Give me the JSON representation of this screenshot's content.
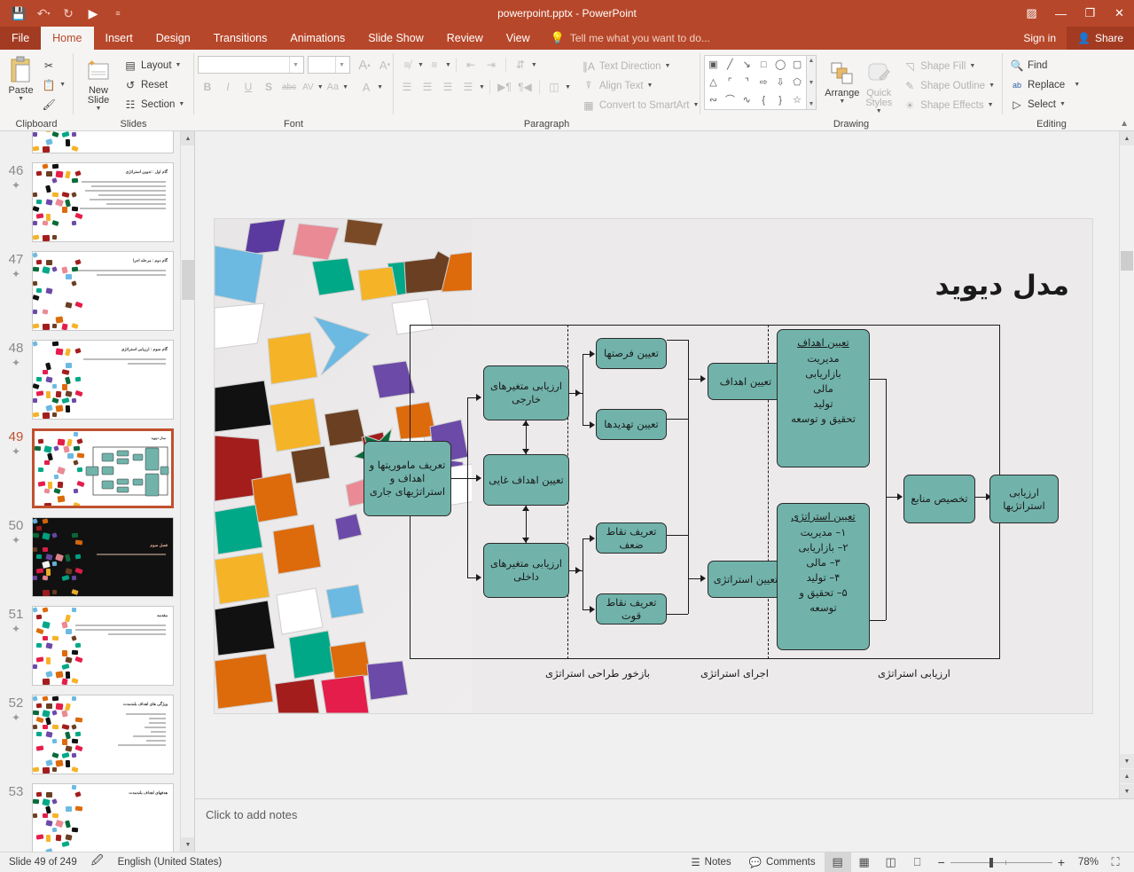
{
  "window": {
    "title": "powerpoint.pptx - PowerPoint",
    "quick_access": [
      {
        "name": "save-icon",
        "glyph": "💾"
      },
      {
        "name": "undo-icon",
        "glyph": "↶"
      },
      {
        "name": "redo-icon",
        "glyph": "↻"
      },
      {
        "name": "start-slideshow-icon",
        "glyph": "▶"
      },
      {
        "name": "customize-qat-icon",
        "glyph": "≡"
      }
    ],
    "controls": [
      {
        "name": "ribbon-display-options",
        "glyph": "▣"
      },
      {
        "name": "minimize",
        "glyph": "—"
      },
      {
        "name": "restore",
        "glyph": "❐"
      },
      {
        "name": "close",
        "glyph": "✕"
      }
    ]
  },
  "tabs": [
    {
      "label": "File",
      "active": false
    },
    {
      "label": "Home",
      "active": true
    },
    {
      "label": "Insert",
      "active": false
    },
    {
      "label": "Design",
      "active": false
    },
    {
      "label": "Transitions",
      "active": false
    },
    {
      "label": "Animations",
      "active": false
    },
    {
      "label": "Slide Show",
      "active": false
    },
    {
      "label": "Review",
      "active": false
    },
    {
      "label": "View",
      "active": false
    }
  ],
  "tell_me": "Tell me what you want to do...",
  "sign_in": "Sign in",
  "share": "Share",
  "ribbon": {
    "clipboard": {
      "label": "Clipboard",
      "paste": "Paste",
      "cut_icon": "scissors-icon",
      "copy_icon": "copy-icon",
      "format_painter_icon": "format-painter-icon"
    },
    "slides": {
      "label": "Slides",
      "new_slide": "New Slide",
      "layout": "Layout",
      "reset": "Reset",
      "section": "Section"
    },
    "font": {
      "label": "Font",
      "font_name": "",
      "font_size": "",
      "grow_font": "A",
      "shrink_font": "A",
      "clear_formatting": "clear-formatting-icon",
      "bold": "B",
      "italic": "I",
      "underline": "U",
      "shadow": "S",
      "strikethrough": "abc",
      "character_spacing": "AV",
      "change_case": "Aa",
      "font_color": "A"
    },
    "paragraph": {
      "label": "Paragraph",
      "text_direction": "Text Direction",
      "align_text": "Align Text",
      "convert_to_smartart": "Convert to SmartArt"
    },
    "drawing": {
      "label": "Drawing",
      "arrange": "Arrange",
      "quick_styles": "Quick Styles",
      "shape_fill": "Shape Fill",
      "shape_outline": "Shape Outline",
      "shape_effects": "Shape Effects",
      "shapes": [
        "A≡",
        "╲",
        "↘",
        "□",
        "◯",
        "▢",
        "△",
        "┐",
        "┗",
        "⇨",
        "⇩",
        "⌐",
        "ʃ",
        "⌒",
        "∿",
        "{",
        "}",
        "☆"
      ]
    },
    "editing": {
      "label": "Editing",
      "find": "Find",
      "replace": "Replace",
      "select": "Select"
    }
  },
  "thumbnails": [
    {
      "number": "",
      "title": "",
      "lines": 0,
      "selected": false,
      "dark": false,
      "partial": true
    },
    {
      "number": "46",
      "title": "گام اول : تدوین استراتژی",
      "lines": 7,
      "selected": false,
      "dark": false
    },
    {
      "number": "47",
      "title": "گام دوم : مرحله اجرا",
      "lines": 2,
      "selected": false,
      "dark": false
    },
    {
      "number": "48",
      "title": "گام سوم : ارزیابی استراتژی",
      "lines": 2,
      "selected": false,
      "dark": false
    },
    {
      "number": "49",
      "title": "مدل دیوید",
      "lines": 0,
      "selected": true,
      "dark": false,
      "diagram": true
    },
    {
      "number": "50",
      "title": "فصل سوم",
      "lines": 1,
      "selected": false,
      "dark": true
    },
    {
      "number": "51",
      "title": "مقدمه",
      "lines": 3,
      "selected": false,
      "dark": false
    },
    {
      "number": "52",
      "title": "ویژگی های اهداف بلندمدت",
      "lines": 7,
      "selected": false,
      "dark": false
    },
    {
      "number": "53",
      "title": "هدفهای اهداف بلندمدت",
      "lines": 0,
      "selected": false,
      "dark": false,
      "partial": true
    }
  ],
  "slide": {
    "title": "مدل دیوید",
    "nodes": {
      "mission": "تعریف ماموریتها و اهداف و استراتژیهای جاری",
      "external": "ارزیابی متغیرهای خارجی",
      "ultimate_goals": "تعیین اهداف غایی",
      "internal": "ارزیابی متغیرهای داخلی",
      "opportunities": "تعیین فرصتها",
      "threats": "تعیین تهدیدها",
      "weaknesses": "تعریف نقاط ضعف",
      "strengths": "تعریف نقاط قوت",
      "set_goals": "تعیین اهداف",
      "set_strategy": "تعیین استراتژی",
      "allocate": "تخصیص منابع",
      "evaluate": "ارزیابی استراتژیها"
    },
    "goals_panel": {
      "header": "تعیین اهداف",
      "items": [
        "مدیریت",
        "بازاریابی",
        "مالی",
        "تولید",
        "تحقیق و توسعه"
      ]
    },
    "strategy_panel": {
      "header": "تعیین استراتژی",
      "items": [
        "۱– مدیریت",
        "۲– بازاریابی",
        "۳– مالی",
        "۴– تولید",
        "۵– تحقیق و توسعه"
      ]
    },
    "phase_labels": [
      "بازخور طراحی استراتژی",
      "اجرای استراتژی",
      "ارزیابی استراتژی"
    ],
    "accent_color": "#71b3ab"
  },
  "notes_placeholder": "Click to add notes",
  "status": {
    "slide_of": "Slide 49 of 249",
    "language": "English (United States)",
    "notes": "Notes",
    "comments": "Comments",
    "zoom": "78%",
    "views": [
      {
        "name": "normal-view",
        "glyph": "▤",
        "active": true
      },
      {
        "name": "slide-sorter-view",
        "glyph": "▒",
        "active": false
      },
      {
        "name": "reading-view",
        "glyph": "▥",
        "active": false
      },
      {
        "name": "slide-show-view",
        "glyph": "▱",
        "active": false
      }
    ]
  }
}
